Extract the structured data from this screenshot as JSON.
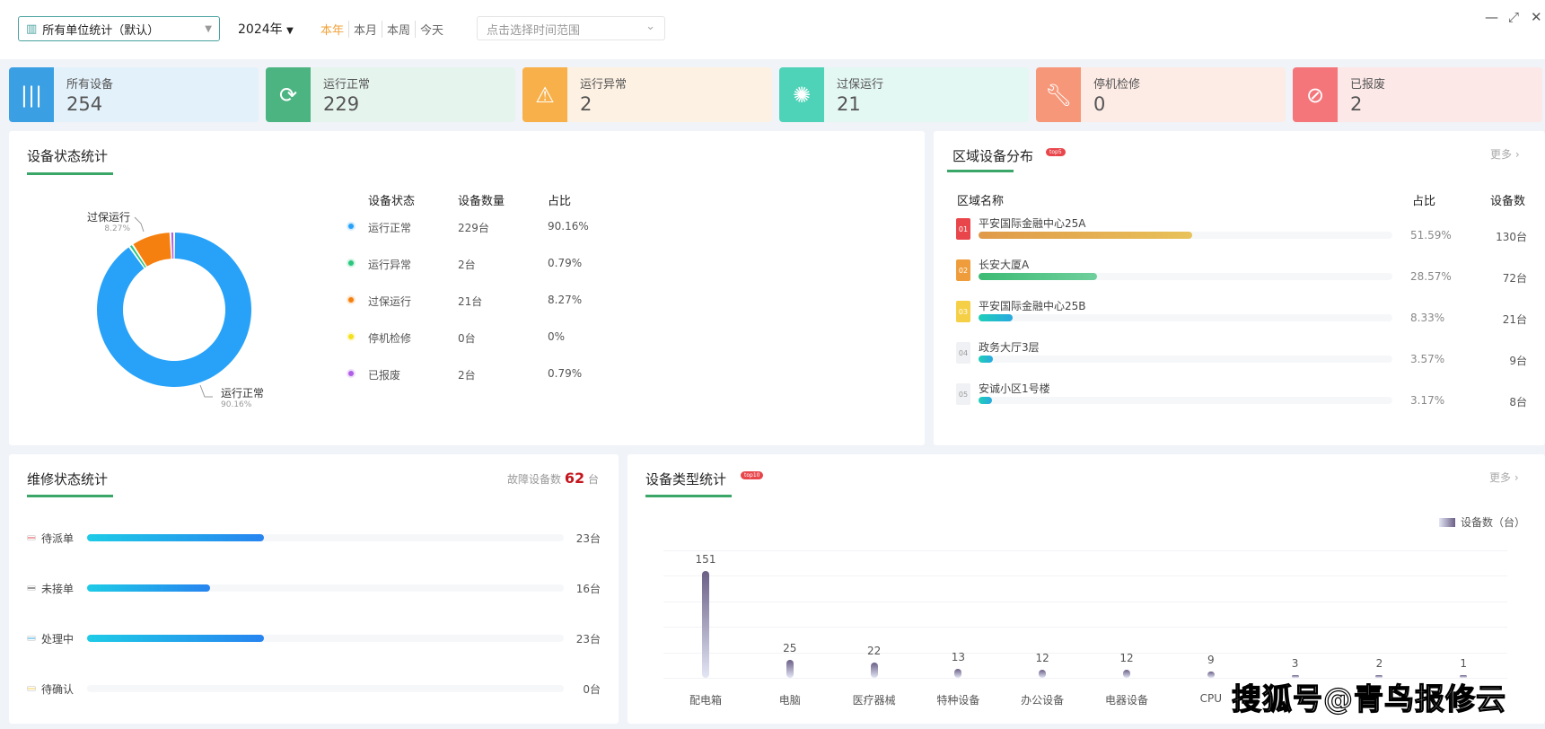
{
  "header": {
    "unit_select": "所有单位统计（默认）",
    "year": "2024年",
    "ranges": [
      "本年",
      "本月",
      "本周",
      "今天"
    ],
    "active_range": "本年",
    "date_placeholder": "点击选择时间范围"
  },
  "kpis": [
    {
      "label": "所有设备",
      "value": "254",
      "color": "#3aa0e3",
      "bg": "#e3f1fa",
      "icon": "bars-icon"
    },
    {
      "label": "运行正常",
      "value": "229",
      "color": "#4cb481",
      "bg": "#e6f4ee",
      "icon": "refresh-check-icon"
    },
    {
      "label": "运行异常",
      "value": "2",
      "color": "#f8b04a",
      "bg": "#fdf1e3",
      "icon": "warning-icon"
    },
    {
      "label": "过保运行",
      "value": "21",
      "color": "#4fd3b8",
      "bg": "#e3f7f3",
      "icon": "alarm-light-icon"
    },
    {
      "label": "停机检修",
      "value": "0",
      "color": "#f7977a",
      "bg": "#fdece6",
      "icon": "wrench-icon"
    },
    {
      "label": "已报废",
      "value": "2",
      "color": "#f4757a",
      "bg": "#fde8e8",
      "icon": "ban-icon"
    }
  ],
  "status": {
    "title": "设备状态统计",
    "headers": [
      "设备状态",
      "设备数量",
      "占比"
    ],
    "rows": [
      {
        "name": "运行正常",
        "count": "229台",
        "pct": "90.16%",
        "value": 229,
        "color": "#27a2f8"
      },
      {
        "name": "运行异常",
        "count": "2台",
        "pct": "0.79%",
        "value": 2,
        "color": "#2ac77f"
      },
      {
        "name": "过保运行",
        "count": "21台",
        "pct": "8.27%",
        "value": 21,
        "color": "#f5800f"
      },
      {
        "name": "停机检修",
        "count": "0台",
        "pct": "0%",
        "value": 0,
        "color": "#f4e01b"
      },
      {
        "name": "已报废",
        "count": "2台",
        "pct": "0.79%",
        "value": 2,
        "color": "#b05ee8"
      }
    ],
    "callouts": [
      {
        "name": "过保运行",
        "pct": "8.27%"
      },
      {
        "name": "运行正常",
        "pct": "90.16%"
      }
    ]
  },
  "region": {
    "title": "区域设备分布",
    "badge": "top5",
    "more": "更多",
    "headers": [
      "区域名称",
      "占比",
      "设备数"
    ],
    "rows": [
      {
        "rank": "01",
        "name": "平安国际金融中心25A",
        "pct": "51.59%",
        "value": 51.59,
        "count": "130台",
        "rank_color": "#e8464b",
        "bar": "linear-gradient(90deg,#e09a4a,#e8c25a)"
      },
      {
        "rank": "02",
        "name": "长安大厦A",
        "pct": "28.57%",
        "value": 28.57,
        "count": "72台",
        "rank_color": "#ef9d3c",
        "bar": "linear-gradient(90deg,#3cbb74,#6fcf9c)"
      },
      {
        "rank": "03",
        "name": "平安国际金融中心25B",
        "pct": "8.33%",
        "value": 8.33,
        "count": "21台",
        "rank_color": "#f5cf45",
        "bar": "linear-gradient(90deg,#1fcfb8,#29a8e0)"
      },
      {
        "rank": "04",
        "name": "政务大厅3层",
        "pct": "3.57%",
        "value": 3.57,
        "count": "9台",
        "rank_color": "#f0f1f4",
        "bar": "linear-gradient(90deg,#1fcfb8,#29a8e0)"
      },
      {
        "rank": "05",
        "name": "安诚小区1号楼",
        "pct": "3.17%",
        "value": 3.17,
        "count": "8台",
        "rank_color": "#f0f1f4",
        "bar": "linear-gradient(90deg,#1fcfb8,#29a8e0)"
      }
    ]
  },
  "repair": {
    "title": "维修状态统计",
    "fault_label": "故障设备数",
    "fault_count": "62",
    "fault_unit": "台",
    "total": 62,
    "rows": [
      {
        "name": "待派单",
        "count": "23台",
        "value": 23,
        "color": "#e8464b"
      },
      {
        "name": "未接单",
        "count": "16台",
        "value": 16,
        "color": "#333"
      },
      {
        "name": "处理中",
        "count": "23台",
        "value": 23,
        "color": "#29a8e0"
      },
      {
        "name": "待确认",
        "count": "0台",
        "value": 0,
        "color": "#f5cf45"
      }
    ]
  },
  "chart_data": {
    "type": "bar",
    "title": "设备类型统计",
    "badge": "top10",
    "more": "更多",
    "legend": "设备数（台）",
    "legend_position": "top-right",
    "grid": true,
    "categories": [
      "配电箱",
      "电脑",
      "医疗器械",
      "特种设备",
      "办公设备",
      "电器设备",
      "CPU",
      "",
      "",
      ""
    ],
    "values": [
      151,
      25,
      22,
      13,
      12,
      12,
      9,
      3,
      2,
      1
    ],
    "ylim": [
      0,
      180
    ]
  },
  "watermark": "搜狐号@青鸟报修云"
}
